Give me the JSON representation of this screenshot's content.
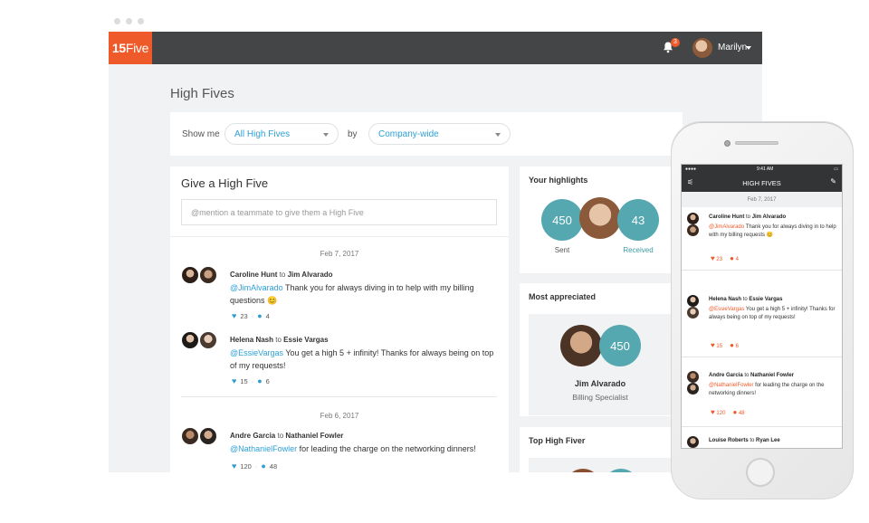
{
  "app": {
    "logo_num": "15",
    "logo_word": "Five",
    "notification_count": "3",
    "user_name": "Marilyn"
  },
  "page": {
    "title": "High Fives"
  },
  "filters": {
    "show_me_label": "Show me",
    "show_me_value": "All High Fives",
    "by_label": "by",
    "scope_value": "Company-wide"
  },
  "feed": {
    "title": "Give a High Five",
    "input_placeholder": "@mention a teammate to give them a High Five",
    "groups": [
      {
        "date": "Feb 7, 2017",
        "entries": [
          {
            "from": "Caroline Hunt",
            "to_word": "to",
            "to": "Jim Alvarado",
            "mention": "@JimAlvarado",
            "message": " Thank you for always diving in to help with my billing questions",
            "emoji": "😊",
            "likes": "23",
            "comments": "4"
          },
          {
            "from": "Helena Nash",
            "to_word": "to",
            "to": "Essie Vargas",
            "mention": "@EssieVargas",
            "message": " You get a high 5 + infinity! Thanks for always being on top of my requests!",
            "emoji": "",
            "likes": "15",
            "comments": "6"
          }
        ]
      },
      {
        "date": "Feb 6, 2017",
        "entries": [
          {
            "from": "Andre Garcia",
            "to_word": "to",
            "to": "Nathaniel Fowler",
            "mention": "@NathanielFowler",
            "message": " for leading the charge on the networking dinners!",
            "emoji": "",
            "likes": "120",
            "comments": "48"
          }
        ]
      }
    ]
  },
  "highlights": {
    "title": "Your highlights",
    "sent_value": "450",
    "sent_label": "Sent",
    "received_value": "43",
    "received_label": "Received"
  },
  "most_appreciated": {
    "title": "Most appreciated",
    "count": "450",
    "name": "Jim Alvarado",
    "role": "Billing Specialist"
  },
  "top_high_fiver": {
    "title": "Top High Fiver"
  },
  "phone": {
    "time": "9:41 AM",
    "title": "HIGH FIVES",
    "date": "Feb 7, 2017",
    "entries": [
      {
        "from": "Caroline Hunt",
        "to_word": "to",
        "to": "Jim Alvarado",
        "mention": "@JimAlvarado",
        "message": " Thank you for always diving in to help with my billing requests",
        "emoji": "😊",
        "likes": "23",
        "comments": "4"
      },
      {
        "from": "Helena Nash",
        "to_word": "to",
        "to": "Essie Vargas",
        "mention": "@EssieVargas",
        "message": " You get a high 5 + infinity! Thanks for always being on top of my requests!",
        "emoji": "",
        "likes": "15",
        "comments": "6"
      },
      {
        "from": "Andre Garcia",
        "to_word": "to",
        "to": "Nathaniel Fowler",
        "mention": "@NathanielFowler",
        "message": " for leading the charge on the networking dinners!",
        "emoji": "",
        "likes": "120",
        "comments": "48"
      },
      {
        "from": "Louise Roberts",
        "to_word": "to",
        "to": "Ryan Lee",
        "mention": "",
        "message": "",
        "emoji": "",
        "likes": "",
        "comments": ""
      }
    ]
  },
  "colors": {
    "brand": "#ee5a2a",
    "topbar": "#444546",
    "teal": "#55a7b0",
    "link": "#2e9fd6"
  }
}
